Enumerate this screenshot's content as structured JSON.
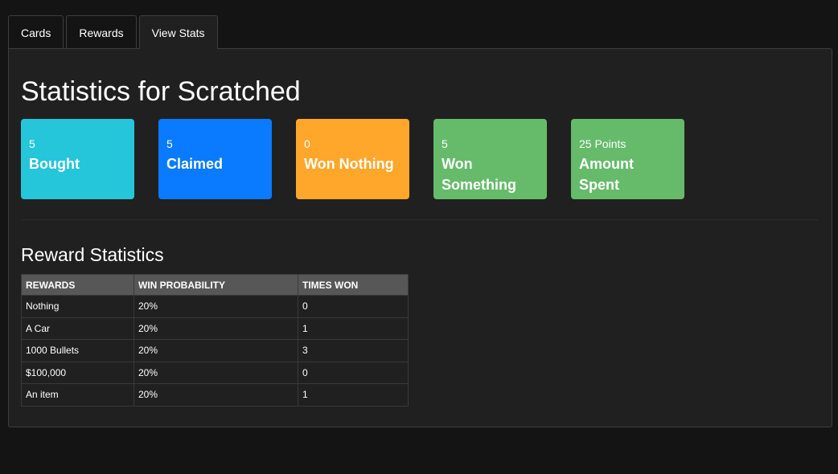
{
  "tabs": [
    {
      "label": "Cards",
      "active": false
    },
    {
      "label": "Rewards",
      "active": false
    },
    {
      "label": "View Stats",
      "active": true
    }
  ],
  "page_title": "Statistics for Scratched",
  "stats": [
    {
      "value": "5",
      "label": "Bought",
      "color": "#25c5da"
    },
    {
      "value": "5",
      "label": "Claimed",
      "color": "#0a7bff"
    },
    {
      "value": "0",
      "label": "Won Nothing",
      "color": "#ffa72a"
    },
    {
      "value": "5",
      "label": "Won Something",
      "color": "#66bb6a"
    },
    {
      "value": "25 Points",
      "label": "Amount Spent",
      "color": "#66bb6a"
    }
  ],
  "reward_section": {
    "title": "Reward Statistics",
    "columns": [
      "REWARDS",
      "WIN PROBABILITY",
      "TIMES WON"
    ],
    "rows": [
      [
        "Nothing",
        "20%",
        "0"
      ],
      [
        "A Car",
        "20%",
        "1"
      ],
      [
        "1000 Bullets",
        "20%",
        "3"
      ],
      [
        "$100,000",
        "20%",
        "0"
      ],
      [
        "An item",
        "20%",
        "1"
      ]
    ]
  }
}
